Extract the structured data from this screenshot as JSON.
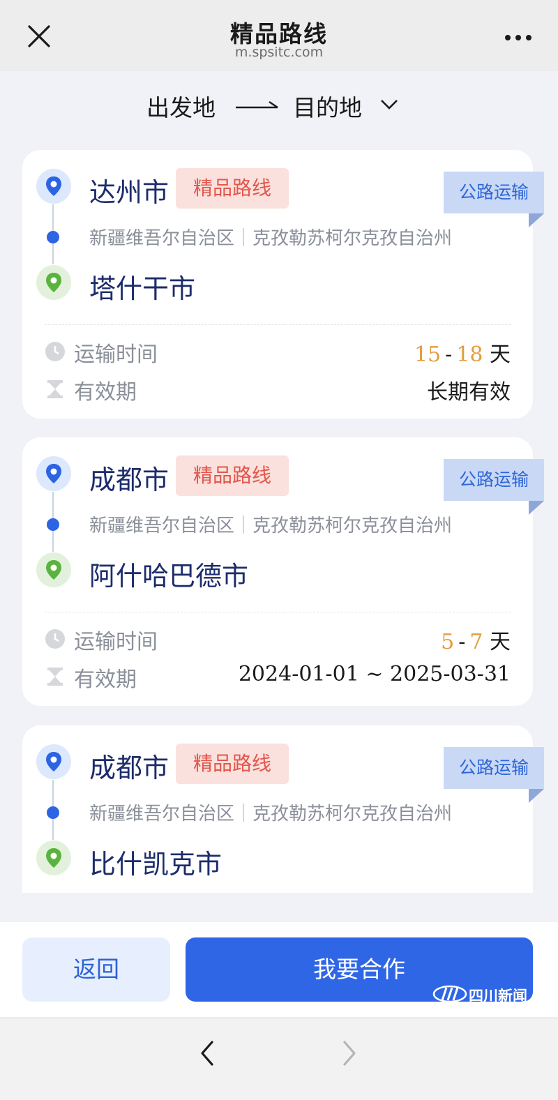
{
  "header": {
    "title": "精品路线",
    "subtitle": "m.spsitc.com",
    "close_icon": "close-icon",
    "more_icon": "more-icon"
  },
  "route_selector": {
    "origin": "出发地",
    "destination": "目的地"
  },
  "routes": [
    {
      "from": "达州市",
      "badge": "精品路线",
      "transport": "公路运输",
      "region": "新疆维吾尔自治区",
      "prefecture": "克孜勒苏柯尔克孜自治州",
      "to": "塔什干市",
      "time_label": "运输时间",
      "time_min": "15",
      "time_max": "18",
      "time_unit": "天",
      "validity_label": "有效期",
      "validity": "长期有效"
    },
    {
      "from": "成都市",
      "badge": "精品路线",
      "transport": "公路运输",
      "region": "新疆维吾尔自治区",
      "prefecture": "克孜勒苏柯尔克孜自治州",
      "to": "阿什哈巴德市",
      "time_label": "运输时间",
      "time_min": "5",
      "time_max": "7",
      "time_unit": "天",
      "validity_label": "有效期",
      "validity": "2024-01-01 ~ 2025-03-31"
    },
    {
      "from": "成都市",
      "badge": "精品路线",
      "transport": "公路运输",
      "region": "新疆维吾尔自治区",
      "prefecture": "克孜勒苏柯尔克孜自治州",
      "to": "比什凯克市"
    }
  ],
  "actions": {
    "back": "返回",
    "cooperate": "我要合作"
  },
  "watermark": {
    "text": "四川新闻"
  },
  "colors": {
    "primary": "#2f66e6",
    "badge_red": "#e2574c",
    "badge_blue_bg": "#c9d8f5",
    "duration_orange": "#e49b3c",
    "city_navy": "#1d2c6b"
  }
}
